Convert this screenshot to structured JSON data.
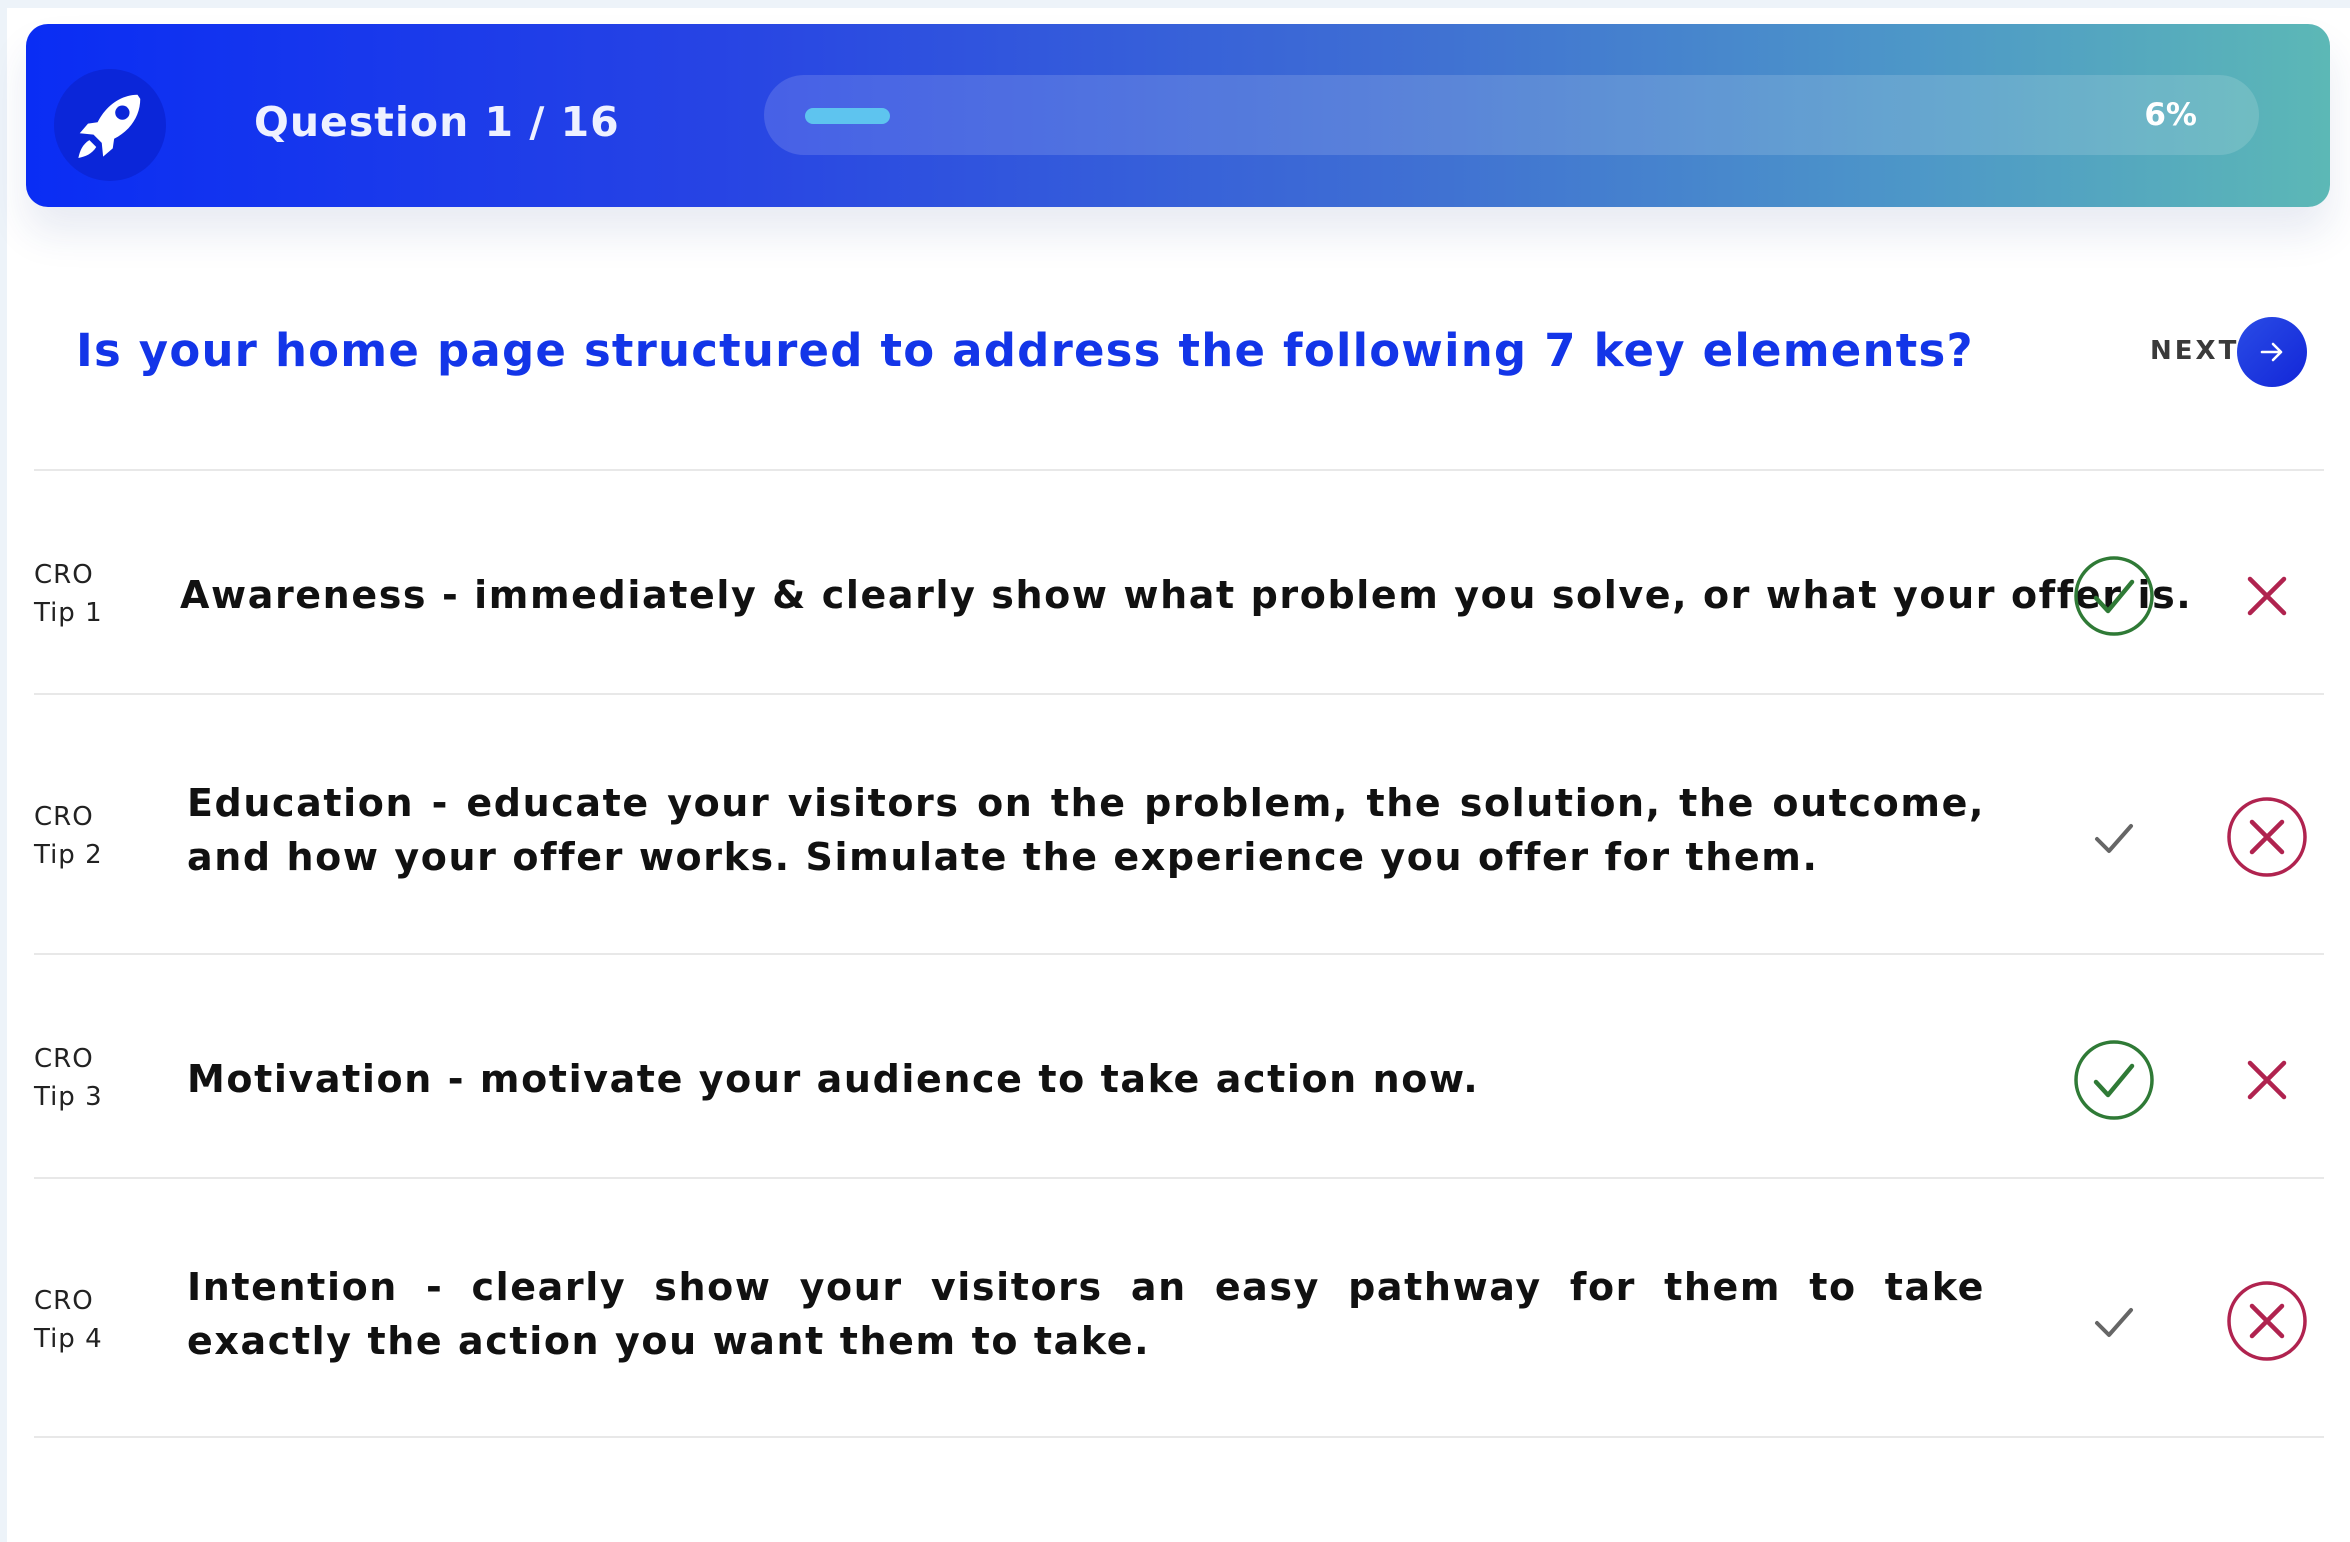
{
  "header": {
    "question_counter": "Question 1 / 16",
    "progress_fraction": 0.06,
    "progress_label": "6%",
    "logo_icon": "rocket-icon"
  },
  "question": {
    "text": "Is your home page structured to address the following 7 key elements?",
    "next_label": "NEXT",
    "next_icon": "arrow-right-icon"
  },
  "colors": {
    "accent_blue": "#1335e8",
    "yes_selected": "#2f7a36",
    "no_selected": "#b0234f",
    "unselected": "#666666"
  },
  "tips": [
    {
      "label_line1": "CRO",
      "label_line2": "Tip 1",
      "text": "Awareness - immediately & clearly show what problem you solve, or what your offer is.",
      "answer": "yes"
    },
    {
      "label_line1": "CRO",
      "label_line2": "Tip 2",
      "text": "Education - educate your visitors on the problem, the solution, the outcome, and how your offer works. Simulate the experience you offer for them.",
      "answer": "no"
    },
    {
      "label_line1": "CRO",
      "label_line2": "Tip 3",
      "text": "Motivation - motivate your audience to take action now.",
      "answer": "yes"
    },
    {
      "label_line1": "CRO",
      "label_line2": "Tip 4",
      "text": "Intention - clearly show your visitors an easy pathway for them to take exactly the action you want them to take.",
      "answer": "no"
    }
  ]
}
